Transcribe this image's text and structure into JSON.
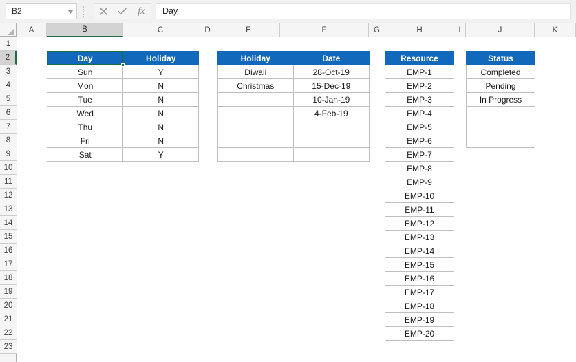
{
  "formula_bar": {
    "name_box_value": "B2",
    "name_box_arrow_icon": "chevron-down-icon",
    "cancel_icon": "cancel-x-icon",
    "confirm_icon": "checkmark-icon",
    "function_icon": "fx-insert-function-icon",
    "function_icon_label": "fx",
    "formula_value": "Day",
    "formula_placeholder": ""
  },
  "grid": {
    "select_all_icon": "select-all-triangle-icon",
    "column_headers": [
      "A",
      "B",
      "C",
      "D",
      "E",
      "F",
      "G",
      "H",
      "I",
      "J",
      "K"
    ],
    "selected_column": "B",
    "row_headers": [
      "1",
      "2",
      "3",
      "4",
      "5",
      "6",
      "7",
      "8",
      "9",
      "10",
      "11",
      "12",
      "13",
      "14",
      "15",
      "16",
      "17",
      "18",
      "19",
      "20",
      "21",
      "22",
      "23"
    ],
    "selected_row": "2",
    "active_cell": "B2"
  },
  "tables": {
    "day_holiday": {
      "headers": [
        "Day",
        "Holiday"
      ],
      "rows": [
        [
          "Sun",
          "Y"
        ],
        [
          "Mon",
          "N"
        ],
        [
          "Tue",
          "N"
        ],
        [
          "Wed",
          "N"
        ],
        [
          "Thu",
          "N"
        ],
        [
          "Fri",
          "N"
        ],
        [
          "Sat",
          "Y"
        ]
      ]
    },
    "holiday_date": {
      "headers": [
        "Holiday",
        "Date"
      ],
      "rows": [
        [
          "Diwali",
          "28-Oct-19"
        ],
        [
          "Christmas",
          "15-Dec-19"
        ],
        [
          "",
          "10-Jan-19"
        ],
        [
          "",
          "4-Feb-19"
        ],
        [
          "",
          ""
        ],
        [
          "",
          ""
        ],
        [
          "",
          ""
        ]
      ]
    },
    "resource": {
      "headers": [
        "Resource"
      ],
      "rows": [
        [
          "EMP-1"
        ],
        [
          "EMP-2"
        ],
        [
          "EMP-3"
        ],
        [
          "EMP-4"
        ],
        [
          "EMP-5"
        ],
        [
          "EMP-6"
        ],
        [
          "EMP-7"
        ],
        [
          "EMP-8"
        ],
        [
          "EMP-9"
        ],
        [
          "EMP-10"
        ],
        [
          "EMP-11"
        ],
        [
          "EMP-12"
        ],
        [
          "EMP-13"
        ],
        [
          "EMP-14"
        ],
        [
          "EMP-15"
        ],
        [
          "EMP-16"
        ],
        [
          "EMP-17"
        ],
        [
          "EMP-18"
        ],
        [
          "EMP-19"
        ],
        [
          "EMP-20"
        ]
      ]
    },
    "status": {
      "headers": [
        "Status"
      ],
      "rows": [
        [
          "Completed"
        ],
        [
          "Pending"
        ],
        [
          "In Progress"
        ],
        [
          ""
        ],
        [
          ""
        ],
        [
          ""
        ]
      ]
    }
  },
  "colors": {
    "header_blue": "#1268ba",
    "selection_green": "#1e6c41",
    "cell_border": "#bfbfbf",
    "chrome_gray": "#f1f1f1"
  }
}
